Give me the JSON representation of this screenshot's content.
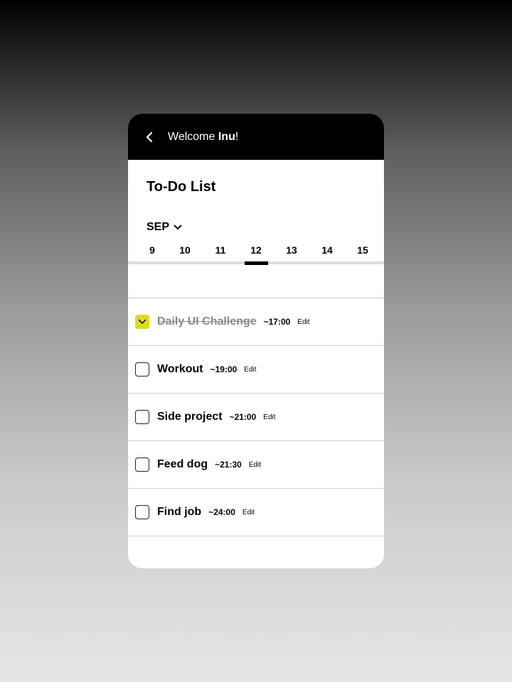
{
  "header": {
    "greeting_prefix": "Welcome ",
    "user_name": "Inu",
    "greeting_suffix": "!"
  },
  "page": {
    "title": "To-Do List"
  },
  "calendar": {
    "month": "SEP",
    "dates": [
      "9",
      "10",
      "11",
      "12",
      "13",
      "14",
      "15"
    ],
    "selected": "12"
  },
  "tasks": [
    {
      "name": "Daily UI Challenge",
      "time": "~17:00",
      "edit": "Edit",
      "done": true
    },
    {
      "name": "Workout",
      "time": "~19:00",
      "edit": "Edit",
      "done": false
    },
    {
      "name": "Side project",
      "time": "~21:00",
      "edit": "Edit",
      "done": false
    },
    {
      "name": "Feed dog",
      "time": "~21:30",
      "edit": "Edit",
      "done": false
    },
    {
      "name": "Find job",
      "time": "~24:00",
      "edit": "Edit",
      "done": false
    }
  ],
  "colors": {
    "accent": "#dcdc1e",
    "header_bg": "#000000"
  },
  "icons": {
    "back": "chevron-left-icon",
    "month_toggle": "chevron-down-icon",
    "check": "check-icon"
  }
}
